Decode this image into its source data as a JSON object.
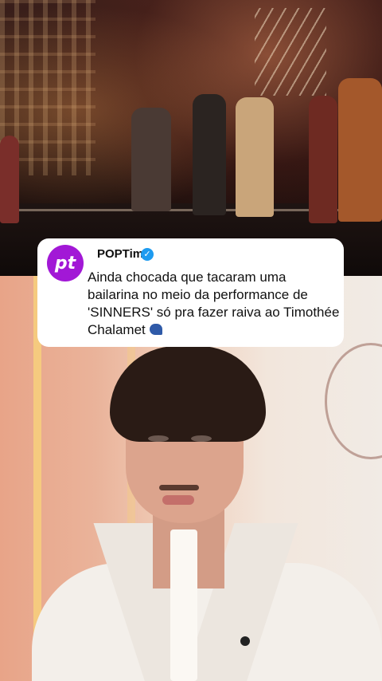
{
  "post": {
    "account_name": "POPTime",
    "avatar_text": "pt",
    "verified": true,
    "text": "Ainda chocada que tacaram uma bailarina no meio da performance de 'SINNERS' só pra fazer raiva ao Timothée Chalamet",
    "emoji_icon": "speaking-head-icon"
  },
  "colors": {
    "brand": "#a218d6",
    "verified": "#1d9bf0",
    "card_bg": "#ffffff"
  }
}
